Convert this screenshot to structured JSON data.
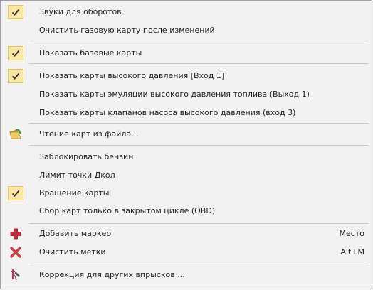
{
  "menu": {
    "items": [
      {
        "label": "Звуки для оборотов",
        "checked": true
      },
      {
        "label": "Очистить газовую карту после изменений",
        "checked": false
      },
      {
        "label": "Показать базовые карты",
        "checked": true
      },
      {
        "label": "Показать карты высокого давления [Вход 1]",
        "checked": true
      },
      {
        "label": "Показать карты эмуляции высокого давления топлива (Выход 1)",
        "checked": false
      },
      {
        "label": "Показать карты клапанов насоса высокого давления (вход 3)",
        "checked": false
      },
      {
        "label": "Чтение карт из файла...",
        "icon": "open-folder-icon"
      },
      {
        "label": "Заблокировать бензин",
        "checked": false
      },
      {
        "label": "Лимит точки Дкол",
        "checked": false
      },
      {
        "label": "Вращение карты",
        "checked": true
      },
      {
        "label": "Сбор карт только в закрытом цикле (OBD)",
        "checked": false
      },
      {
        "label": "Добавить маркер",
        "icon": "plus-icon",
        "shortcut": "Место"
      },
      {
        "label": "Очистить метки",
        "icon": "red-x-icon",
        "shortcut": "Alt+M"
      },
      {
        "label": "Коррекция для других впрысков ...",
        "icon": "injector-icon"
      }
    ]
  },
  "colors": {
    "check_highlight": "#fbe7a3",
    "check_border": "#e7c45a",
    "plus": "#c8283a",
    "x_mark": "#d23a3a"
  }
}
